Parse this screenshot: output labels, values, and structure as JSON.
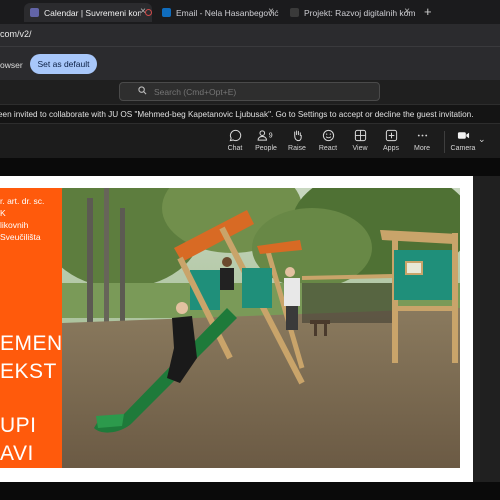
{
  "browser": {
    "tabs": [
      {
        "title": "Calendar | Suvremeni kon",
        "active": true,
        "favicon_color": "#6264a7",
        "recording": true
      },
      {
        "title": "Email - Nela Hasanbegović -",
        "active": false,
        "favicon_color": "#0f6cbd",
        "recording": false
      },
      {
        "title": "Projekt: Razvoj digitalnih kom",
        "active": false,
        "favicon_color": "#3a3a3a",
        "recording": false
      }
    ],
    "close_glyph": "×",
    "new_tab_glyph": "+",
    "url": "com/v2/"
  },
  "default_bar": {
    "text": "owser",
    "button_label": "Set as default"
  },
  "teams": {
    "search_placeholder": "Search (Cmd+Opt+E)"
  },
  "notice": {
    "text": "een invited to collaborate with JU OS \"Mehmed-beg Kapetanovic Ljubusak\". Go to Settings to accept or decline the guest invitation."
  },
  "toolbar": {
    "chat": "Chat",
    "people": "People",
    "people_count": "9",
    "raise": "Raise",
    "react": "React",
    "view": "View",
    "apps": "Apps",
    "more": "More",
    "camera": "Camera"
  },
  "slide": {
    "panel_color": "#ff5a0c",
    "line1": "r. art. dr. sc.",
    "line2": "K",
    "line3": " likovnih",
    "line4": " Sveučilišta",
    "title1": "EMENI",
    "title2": "EKST I",
    "title3": "UPI",
    "title4": "AVI"
  },
  "colors": {
    "accent": "#a8c7fa",
    "orange": "#ff5a0c",
    "slide_green": "#1e7a3a"
  }
}
